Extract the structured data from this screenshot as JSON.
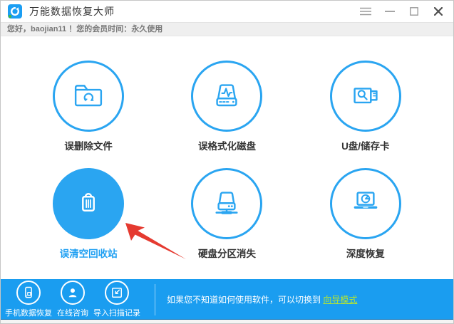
{
  "window": {
    "title": "万能数据恢复大师",
    "controls": {
      "menu_icon": "hamburger-menu",
      "minimize_icon": "minus-line",
      "maximize_icon": "square-outline",
      "close_icon": "x-cross"
    }
  },
  "userbar": {
    "greeting": "您好，baojian11 ！您的会员时间：永久使用"
  },
  "main": {
    "features": [
      {
        "id": "deleted-files",
        "label": "误删除文件",
        "icon": "folder-recycle-icon",
        "selected": false
      },
      {
        "id": "formatted-disk",
        "label": "误格式化磁盘",
        "icon": "disk-pulse-icon",
        "selected": false
      },
      {
        "id": "usb-storage",
        "label": "U盘/储存卡",
        "icon": "usb-search-icon",
        "selected": false
      },
      {
        "id": "recycle-bin",
        "label": "误清空回收站",
        "icon": "trash-icon",
        "selected": true
      },
      {
        "id": "lost-partition",
        "label": "硬盘分区消失",
        "icon": "drive-partition-icon",
        "selected": false
      },
      {
        "id": "deep-recovery",
        "label": "深度恢复",
        "icon": "laptop-recovery-icon",
        "selected": false
      }
    ],
    "annotation": {
      "type": "red-arrow",
      "points_to": "误清空回收站",
      "color": "#e53a30"
    }
  },
  "bottombar": {
    "items": [
      {
        "label": "手机数据恢复",
        "icon": "phone-icon"
      },
      {
        "label": "在线咨询",
        "icon": "person-icon"
      },
      {
        "label": "导入扫描记录",
        "icon": "import-record-icon"
      }
    ],
    "hint_text": "如果您不知道如何使用软件，可以切换到",
    "hint_link": "向导模式"
  },
  "colors": {
    "primary_blue": "#1e9ff2",
    "link_green": "#b8e62e",
    "arrow_red": "#e53a30",
    "label_dark": "#333333"
  }
}
